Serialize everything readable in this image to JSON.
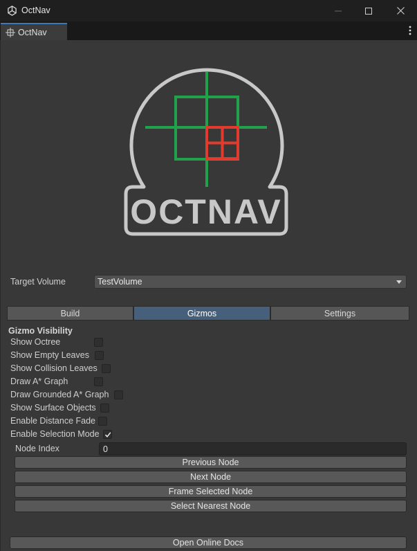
{
  "window": {
    "title": "OctNav",
    "controls": [
      "minimize-icon",
      "maximize-icon",
      "close-icon"
    ]
  },
  "doc_tab": {
    "label": "OctNav",
    "icon": "crosshair-icon"
  },
  "menu_icon": "kebab-menu-icon",
  "logo": {
    "text": "OCTNAV",
    "colors": {
      "outline": "#c8c8c8",
      "grid": "#1fa24a",
      "target": "#e23b2e"
    }
  },
  "target_volume": {
    "label": "Target Volume",
    "value": "TestVolume"
  },
  "tabs": [
    {
      "label": "Build",
      "active": false
    },
    {
      "label": "Gizmos",
      "active": true
    },
    {
      "label": "Settings",
      "active": false
    }
  ],
  "gizmo_section": {
    "header": "Gizmo Visibility",
    "toggles": [
      {
        "label": "Show Octree",
        "checked": false
      },
      {
        "label": "Show Empty Leaves",
        "checked": false
      },
      {
        "label": "Show Collision Leaves",
        "checked": false
      },
      {
        "label": "Draw A* Graph",
        "checked": false
      },
      {
        "label": "Draw Grounded A* Graph",
        "checked": false
      },
      {
        "label": "Show Surface Objects",
        "checked": false
      },
      {
        "label": "Enable Distance Fade",
        "checked": false
      },
      {
        "label": "Enable Selection Mode",
        "checked": true
      }
    ]
  },
  "node_index": {
    "label": "Node Index",
    "value": "0"
  },
  "buttons": {
    "previous_node": "Previous Node",
    "next_node": "Next Node",
    "frame_selected_node": "Frame Selected Node",
    "select_nearest_node": "Select Nearest Node",
    "open_online_docs": "Open Online Docs"
  },
  "colors": {
    "background": "#383838",
    "active_tab": "#46607c",
    "tab_accent": "#3a79bb"
  }
}
